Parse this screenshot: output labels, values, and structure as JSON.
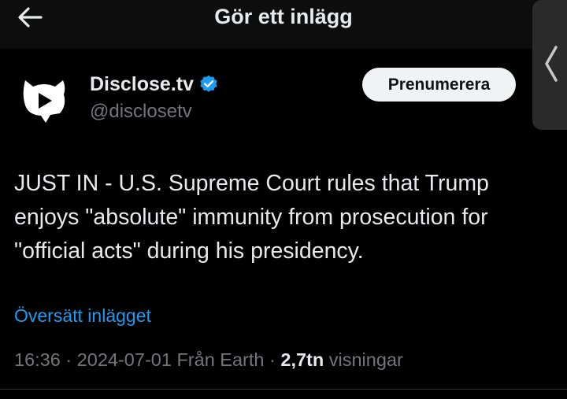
{
  "header": {
    "title": "Gör ett inlägg",
    "back_icon": "arrow-left-icon"
  },
  "tweet": {
    "author_name": "Disclose.tv",
    "author_handle": "@disclosetv",
    "verified_icon": "verified-badge-icon",
    "verified_color": "#1d9bf0",
    "subscribe_label": "Prenumerera",
    "text": "JUST IN - U.S. Supreme Court rules that Trump\nenjoys \"absolute\" immunity from prosecution for\n\"official acts\" during his presidency.",
    "translate_label": "Översätt inlägget",
    "time": "16:36",
    "date": "2024-07-01",
    "source": "Från Earth",
    "views_count": "2,7tn",
    "views_label": "visningar",
    "separator": "·"
  },
  "colors": {
    "background": "#000000",
    "text": "#e7e9ea",
    "muted": "#71767b",
    "link": "#1d9bf0"
  }
}
